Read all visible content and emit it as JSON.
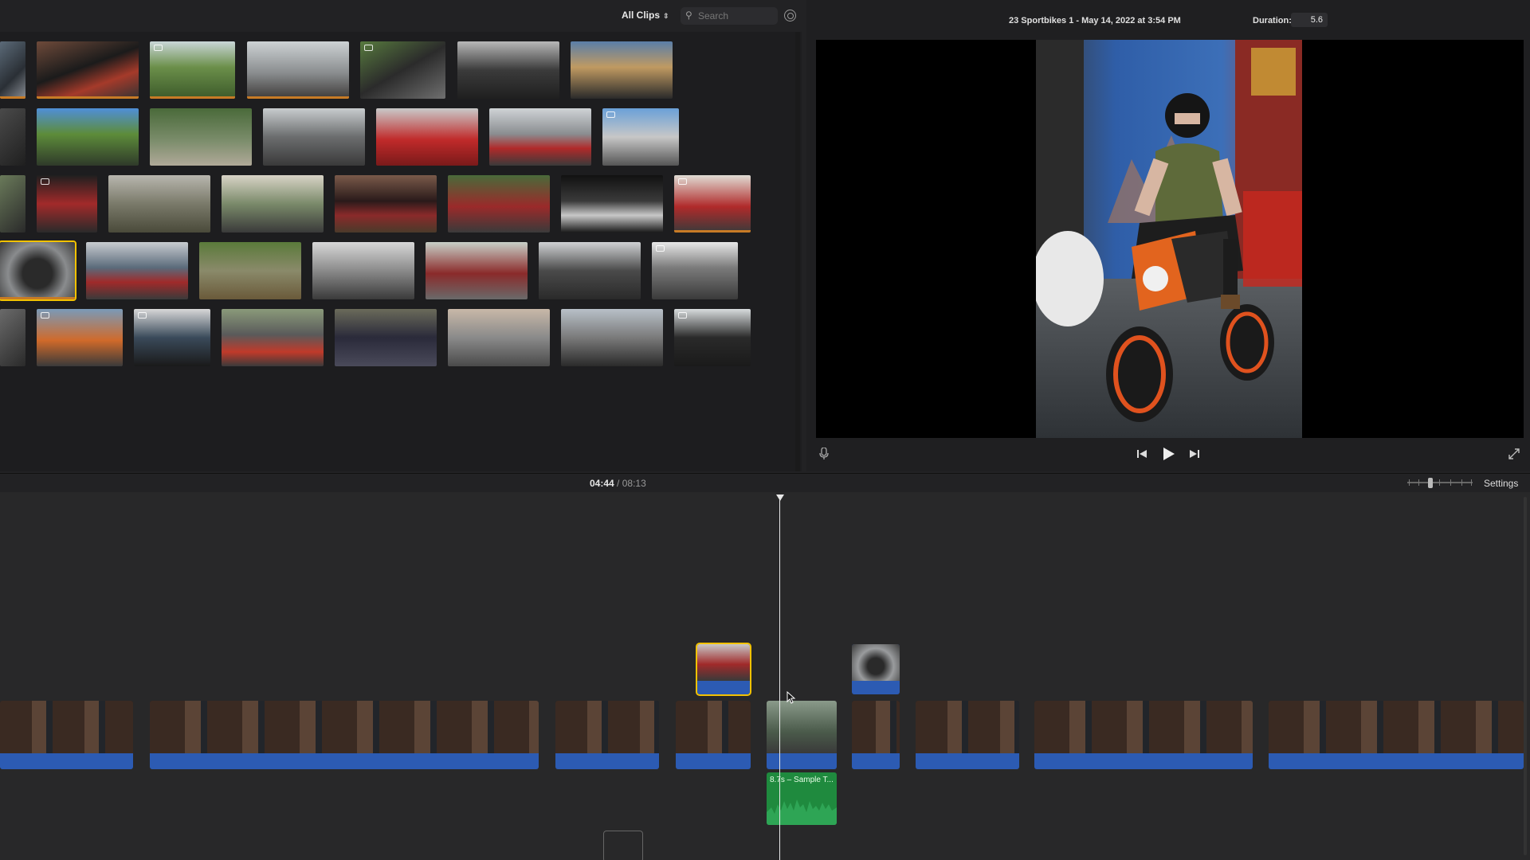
{
  "browser": {
    "clips_filter": "All Clips",
    "search_placeholder": "Search"
  },
  "viewer": {
    "clip_info": "23 Sportbikes 1 - May 14, 2022 at 3:54 PM",
    "duration_label": "Duration:",
    "duration_value": "5.6"
  },
  "timeline": {
    "current_time": "04:44",
    "separator": "/",
    "total_time": "08:13",
    "settings_label": "Settings",
    "music_clip_label": "8.7s – Sample T..."
  },
  "colors": {
    "accent_selection": "#f2c200",
    "audio_blue": "#2c5bb3",
    "music_green": "#1f8a3e",
    "used_clip_bar": "#c77b26"
  }
}
